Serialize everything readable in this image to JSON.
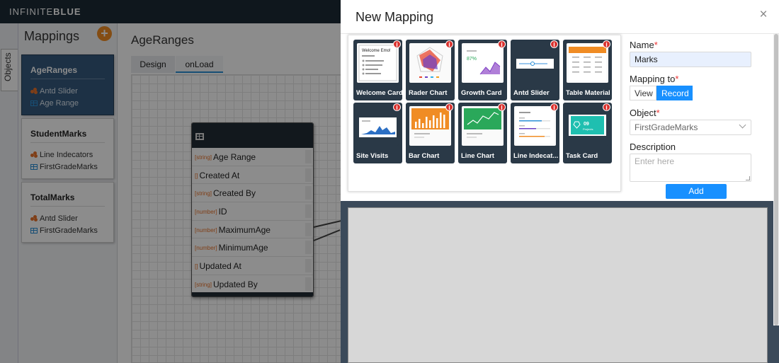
{
  "app": {
    "logo_left": "INFINITE",
    "logo_right": "BLUE",
    "side_tab": "Objects"
  },
  "sidebar": {
    "title": "Mappings",
    "add_icon": "+",
    "cards": [
      {
        "title": "AgeRanges",
        "items": [
          {
            "icon": "component-icon",
            "label": "Antd Slider"
          },
          {
            "icon": "table-icon",
            "label": "Age Range"
          }
        ]
      },
      {
        "title": "StudentMarks",
        "items": [
          {
            "icon": "component-icon",
            "label": "Line Indecators"
          },
          {
            "icon": "table-icon",
            "label": "FirstGradeMarks"
          }
        ]
      },
      {
        "title": "TotalMarks",
        "items": [
          {
            "icon": "component-icon",
            "label": "Antd Slider"
          },
          {
            "icon": "table-icon",
            "label": "FirstGradeMarks"
          }
        ]
      }
    ]
  },
  "canvas": {
    "title": "AgeRanges",
    "tabs": [
      "Design",
      "onLoad"
    ],
    "entity": {
      "fields": [
        {
          "type": "[string]",
          "name": "Age Range"
        },
        {
          "type": "[]",
          "name": "Created At"
        },
        {
          "type": "[string]",
          "name": "Created By"
        },
        {
          "type": "[number]",
          "name": "ID"
        },
        {
          "type": "[number]",
          "name": "MaximumAge"
        },
        {
          "type": "[number]",
          "name": "MinimumAge"
        },
        {
          "type": "[]",
          "name": "Updated At"
        },
        {
          "type": "[string]",
          "name": "Updated By"
        }
      ]
    }
  },
  "modal": {
    "title": "New Mapping",
    "close_label": "×",
    "info_label": "i",
    "templates": [
      "Welcome Card",
      "Rader Chart",
      "Growth Card",
      "Antd Slider",
      "Table Material",
      "Site Visits",
      "Bar Chart",
      "Line Chart",
      "Line Indecat...",
      "Task Card"
    ],
    "thumb_text": {
      "welcome_heading": "Welcome Emo!",
      "task_number": "09",
      "task_caption": "Projects",
      "growth_value": "87%"
    },
    "form": {
      "name_label": "Name",
      "name_value": "Marks",
      "mapping_to_label": "Mapping to",
      "mapping_options": [
        "View",
        "Record"
      ],
      "mapping_selected": "Record",
      "object_label": "Object",
      "object_value": "FirstGradeMarks",
      "description_label": "Description",
      "description_placeholder": "Enter here",
      "add_label": "Add",
      "required_mark": "*"
    }
  }
}
